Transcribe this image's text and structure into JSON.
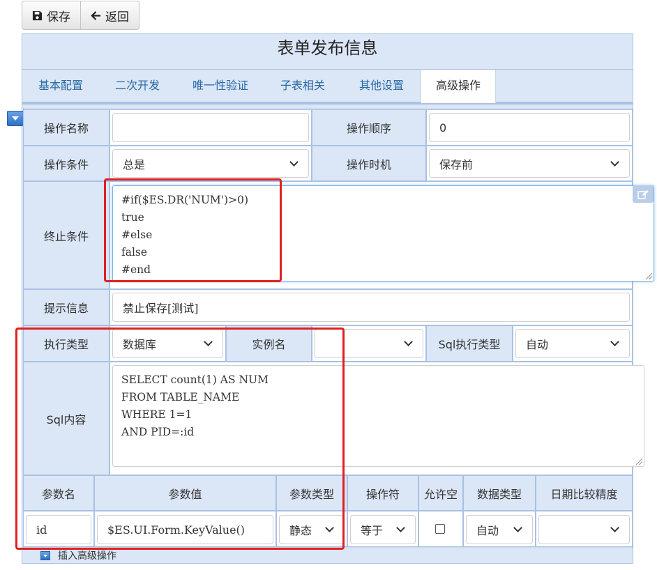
{
  "toolbar": {
    "save_label": "保存",
    "back_label": "返回"
  },
  "form_title": "表单发布信息",
  "tabs": [
    {
      "label": "基本配置"
    },
    {
      "label": "二次开发"
    },
    {
      "label": "唯一性验证"
    },
    {
      "label": "子表相关"
    },
    {
      "label": "其他设置"
    },
    {
      "label": "高级操作",
      "active": true
    }
  ],
  "fields": {
    "op_name_label": "操作名称",
    "op_name_value": "",
    "op_order_label": "操作顺序",
    "op_order_value": "0",
    "op_condition_label": "操作条件",
    "op_condition_value": "总是",
    "op_timing_label": "操作时机",
    "op_timing_value": "保存前",
    "stop_condition_label": "终止条件",
    "stop_condition_value": "#if($ES.DR('NUM')>0)\ntrue\n#else\nfalse\n#end",
    "tip_label": "提示信息",
    "tip_value": "禁止保存[测试]",
    "exec_type_label": "执行类型",
    "exec_type_value": "数据库",
    "instance_label": "实例名",
    "instance_value": "",
    "sql_exec_type_label": "Sql执行类型",
    "sql_exec_type_value": "自动",
    "sql_content_label": "Sql内容",
    "sql_content_value": "SELECT count(1) AS NUM\nFROM TABLE_NAME\nWHERE 1=1\nAND PID=:id"
  },
  "params": {
    "headers": [
      "参数名",
      "参数值",
      "参数类型",
      "操作符",
      "允许空",
      "数据类型",
      "日期比较精度"
    ],
    "row": {
      "name": "id",
      "value": "$ES.UI.Form.KeyValue()",
      "type": "静态",
      "operator": "等于",
      "allow_null": false,
      "data_type": "自动",
      "date_precision": ""
    }
  },
  "insert_label": "插入高级操作",
  "colors": {
    "highlight_box": "#e02020",
    "tab_text": "#2a6aa7",
    "panel_bg": "#dbe6f6"
  }
}
